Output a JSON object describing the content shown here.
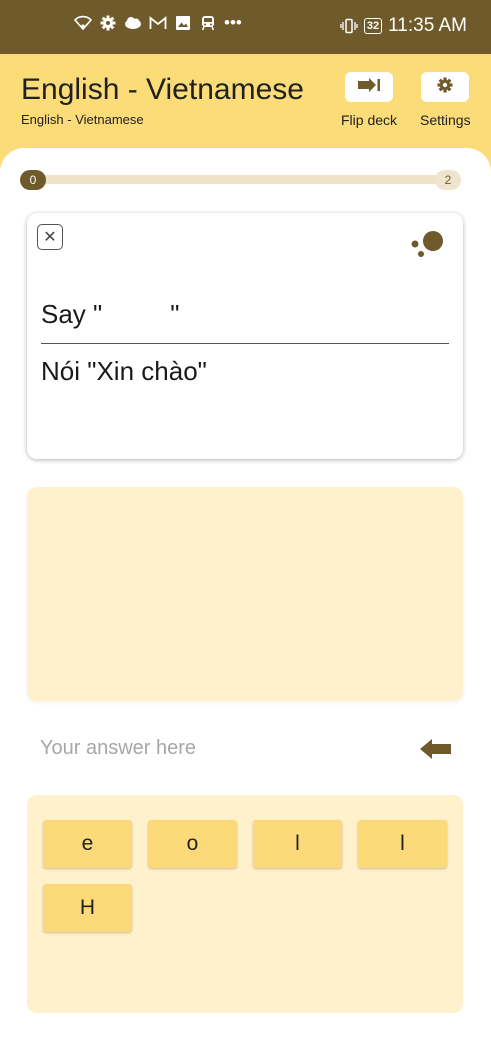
{
  "status_bar": {
    "icons": [
      "wifi-icon",
      "settings-icon",
      "cloud-icon",
      "gmail-icon",
      "image-icon",
      "train-icon",
      "more-icon"
    ],
    "more_label": "•••",
    "battery_icons": [
      "vibrate-icon",
      "battery-icon"
    ],
    "battery_level": "32",
    "time": "11:35 AM"
  },
  "app_bar": {
    "title": "English - Vietnamese",
    "subtitle": "English - Vietnamese",
    "flip_deck_label": "Flip deck",
    "settings_label": "Settings"
  },
  "progress": {
    "current": "0",
    "total": "2",
    "fraction": 0
  },
  "card": {
    "prompt_prefix": "Say \"",
    "prompt_suffix": "\"",
    "translation": "Nói \"Xin chào\""
  },
  "answer": {
    "placeholder": "Your answer here"
  },
  "word_bank": {
    "tiles": [
      "e",
      "o",
      "l",
      "l",
      "H"
    ]
  },
  "colors": {
    "status_bar": "#6e5a2a",
    "app_bar": "#fbdc79",
    "accent_dark": "#6e5a2a",
    "panel": "#fff1cc",
    "tile": "#fcda79"
  }
}
